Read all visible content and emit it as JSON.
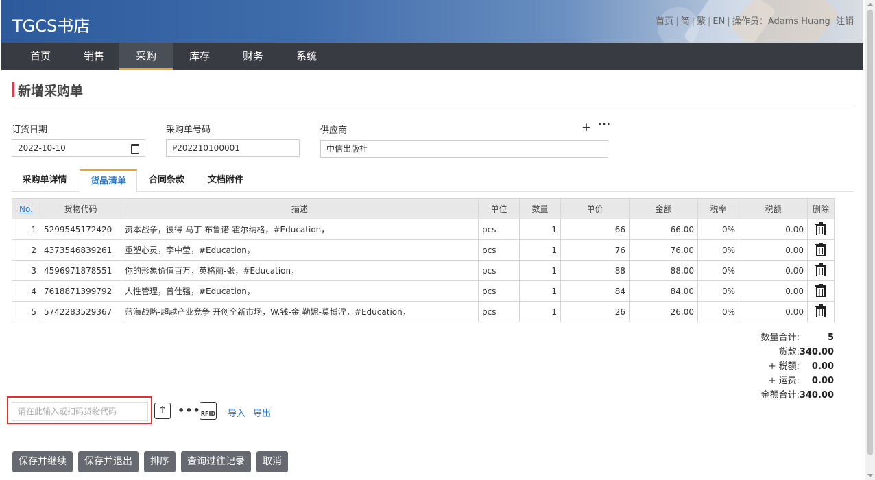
{
  "app": {
    "title": "TGCS书店"
  },
  "header_links": {
    "home": "首页",
    "simplified": "简",
    "traditional": "繁",
    "english": "EN",
    "operator_label": "操作员：",
    "operator_name": "Adams Huang",
    "logout": "注销"
  },
  "nav": {
    "items": [
      "首页",
      "销售",
      "采购",
      "库存",
      "财务",
      "系统"
    ],
    "active": "采购"
  },
  "page": {
    "title": "新增采购单"
  },
  "form": {
    "order_date_label": "订货日期",
    "order_date": "2022-10-10",
    "po_number_label": "采购单号码",
    "po_number": "P202210100001",
    "supplier_label": "供应商",
    "supplier": "中信出版社"
  },
  "tabs": {
    "items": [
      "采购单详情",
      "货品清单",
      "合同条款",
      "文档附件"
    ],
    "active": "货品清单"
  },
  "table": {
    "headers": [
      "No.",
      "货物代码",
      "描述",
      "单位",
      "数量",
      "单价",
      "金额",
      "税率",
      "税额",
      "删除"
    ],
    "rows": [
      [
        "1",
        "5299545172420",
        "资本战争，彼得-马丁 布鲁诺-霍尔纳格，#Education，",
        "pcs",
        "1",
        "66",
        "66.00",
        "0%",
        "0.00"
      ],
      [
        "2",
        "4373546839261",
        "重塑心灵，李中莹，#Education，",
        "pcs",
        "1",
        "76",
        "76.00",
        "0%",
        "0.00"
      ],
      [
        "3",
        "4596971878551",
        "你的形象价值百万，英格丽-张，#Education，",
        "pcs",
        "1",
        "88",
        "88.00",
        "0%",
        "0.00"
      ],
      [
        "4",
        "7618871399792",
        "人性管理，曾仕强，#Education，",
        "pcs",
        "1",
        "84",
        "84.00",
        "0%",
        "0.00"
      ],
      [
        "5",
        "5742283529367",
        "蓝海战略-超越产业竞争 开创全新市场，W.钱-金 勒妮-莫博涅，#Education，",
        "pcs",
        "1",
        "26",
        "26.00",
        "0%",
        "0.00"
      ]
    ]
  },
  "totals": {
    "qty_label": "数量合计:",
    "qty": "5",
    "goods_label": "货款:",
    "goods": "340.00",
    "tax_label": "+ 税额:",
    "tax": "0.00",
    "freight_label": "+ 运费:",
    "freight": "0.00",
    "total_label": "金额合计:",
    "total": "340.00"
  },
  "scan": {
    "placeholder": "请在此输入或扫码货物代码",
    "rfid_label": "RFID",
    "import": "导入",
    "export": "导出"
  },
  "buttons": {
    "save_continue": "保存并继续",
    "save_exit": "保存并退出",
    "sort": "排序",
    "history": "查询过往记录",
    "cancel": "取消"
  },
  "colors": {
    "nav_bg": "#383c42",
    "accent": "#f0a030",
    "title_bar": "#e0384a",
    "link": "#2a7bd0",
    "button_bg": "#666a70",
    "scan_border": "#e03030"
  }
}
